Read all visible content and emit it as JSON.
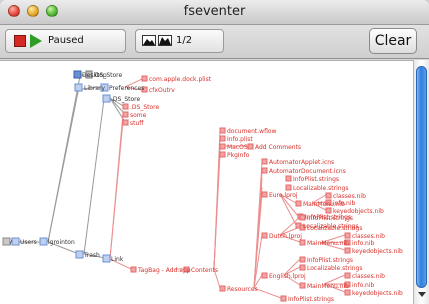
{
  "window": {
    "title": "fseventer"
  },
  "toolbar": {
    "status": "Paused",
    "page_indicator": "1/2",
    "clear_label": "Clear"
  },
  "colors": {
    "tree_gray": "#9a9a9a",
    "tree_red": "#e46a6a",
    "folder": "#6b8fd6",
    "node_red": "#ef8a8a"
  },
  "tree": {
    "root": "/",
    "users": "Users",
    "user": "lgrointon",
    "desktop": "Desktop",
    "desktop_ds": ".DS_Store",
    "library": "Library",
    "preferences": "Preferences",
    "pref_file1": "com.apple.dock.plist",
    "pref_file2": "cfxOutrv",
    "trash": "Trash",
    "trash_ds": ".DS_Store",
    "trash_some": "some",
    "trash_stuff": "stuff",
    "link": "Link",
    "app": "TagBag - Add.app",
    "contents": "Contents",
    "resources": "Resources",
    "c_docrefs": "document.wflow",
    "c_info": "Info.plist",
    "c_macos": "MacOS",
    "c_add": "Add Comments",
    "c_pkginfo": "PkgInfo",
    "r_applet": "AutomatorApplet.icns",
    "r_docicns": "AutomatorDocument.icns",
    "r_infoplist": "InfoPlist.strings",
    "r_localizable": "Localizable.strings",
    "euro_lproj": "Euro.lproj",
    "e_classes": "classes.nib",
    "e_mainmenu": "MainMenu.nib",
    "e_info": "info.nib",
    "e_keyed": "keyedobjects.nib",
    "e_infoplist": "InfoPlist.strings",
    "e_localizable": "Localizable.strings",
    "dutch_lproj": "Dutch.lproj",
    "d_classes": "classes.nib",
    "d_mainmenu": "MainMenu.nib",
    "d_info": "info.nib",
    "d_keyed": "keyedobjects.nib",
    "d_infoplist": "InfoPlist.strings",
    "d_localizable": "Localizable.strings",
    "english_lproj": "English.lproj",
    "en_classes": "classes.nib",
    "en_mainmenu": "MainMenu.nib",
    "en_info": "info.nib",
    "en_keyed": "keyedobjects.nib",
    "en_infoplist": "InfoPlist.strings",
    "en_localizable": "Localizable.strings",
    "bottom_infoplist": "InfoPlist.strings"
  }
}
